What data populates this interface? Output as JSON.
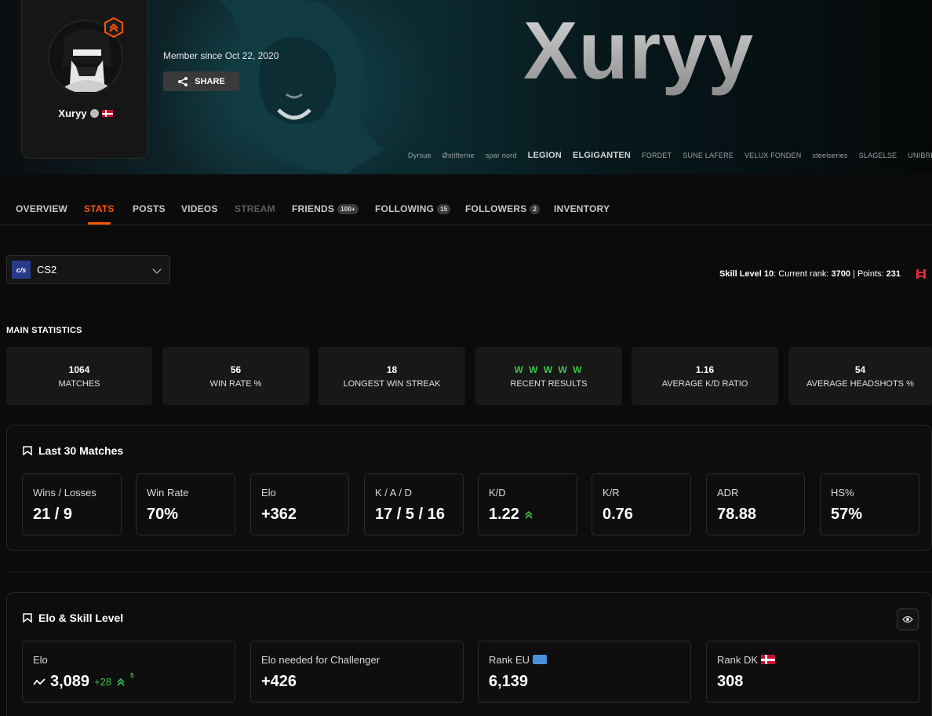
{
  "profile": {
    "name": "Xuryy",
    "banner_name": "Xuryy",
    "member_since": "Member since Oct 22, 2020",
    "share_label": "SHARE"
  },
  "sponsors": [
    "Dyrsue",
    "Østifterne",
    "spar nord",
    "LEGION",
    "ELGIGANTEN",
    "FORDET",
    "SUNE LAFERE",
    "VELUX FONDEN",
    "steelseries",
    "SLAGELSE",
    "UNIBREW"
  ],
  "tabs": [
    {
      "label": "OVERVIEW",
      "state": "normal"
    },
    {
      "label": "STATS",
      "state": "active"
    },
    {
      "label": "POSTS",
      "state": "normal"
    },
    {
      "label": "VIDEOS",
      "state": "normal"
    },
    {
      "label": "STREAM",
      "state": "disabled"
    },
    {
      "label": "FRIENDS",
      "badge": "100+",
      "state": "normal"
    },
    {
      "label": "FOLLOWING",
      "badge": "15",
      "state": "normal"
    },
    {
      "label": "FOLLOWERS",
      "badge": "2",
      "state": "normal"
    },
    {
      "label": "INVENTORY",
      "state": "normal"
    }
  ],
  "game_select": {
    "logo": "c/s",
    "value": "CS2"
  },
  "skill": {
    "level_label": "Skill Level 10",
    "rank_prefix": ": Current rank: ",
    "rank": "3700",
    "points_prefix": " | Points: ",
    "points": "231"
  },
  "main_statistics": {
    "title": "MAIN STATISTICS",
    "items": [
      {
        "value": "1064",
        "label": "MATCHES"
      },
      {
        "value": "56",
        "label": "WIN RATE %"
      },
      {
        "value": "18",
        "label": "LONGEST WIN STREAK"
      },
      {
        "value": "W W W W W",
        "label": "RECENT RESULTS"
      },
      {
        "value": "1.16",
        "label": "AVERAGE K/D RATIO"
      },
      {
        "value": "54",
        "label": "AVERAGE HEADSHOTS %"
      }
    ]
  },
  "last30": {
    "title": "Last 30 Matches",
    "cards": [
      {
        "label": "Wins / Losses",
        "value": "21 / 9"
      },
      {
        "label": "Win Rate",
        "value": "70%"
      },
      {
        "label": "Elo",
        "value": "+362"
      },
      {
        "label": "K / A / D",
        "value": "17 / 5 / 16"
      },
      {
        "label": "K/D",
        "value": "1.22"
      },
      {
        "label": "K/R",
        "value": "0.76"
      },
      {
        "label": "ADR",
        "value": "78.88"
      },
      {
        "label": "HS%",
        "value": "57%"
      }
    ]
  },
  "elo_skill": {
    "title": "Elo & Skill Level",
    "elo": {
      "label": "Elo",
      "value": "3,089",
      "delta": "+28",
      "sup": "5"
    },
    "challenger": {
      "label": "Elo needed for Challenger",
      "value": "+426"
    },
    "rank_eu": {
      "label": "Rank EU",
      "value": "6,139"
    },
    "rank_dk": {
      "label": "Rank DK",
      "value": "308"
    }
  },
  "colors": {
    "accent": "#ff5500",
    "positive": "#3fc34a",
    "panel": "#181818"
  }
}
